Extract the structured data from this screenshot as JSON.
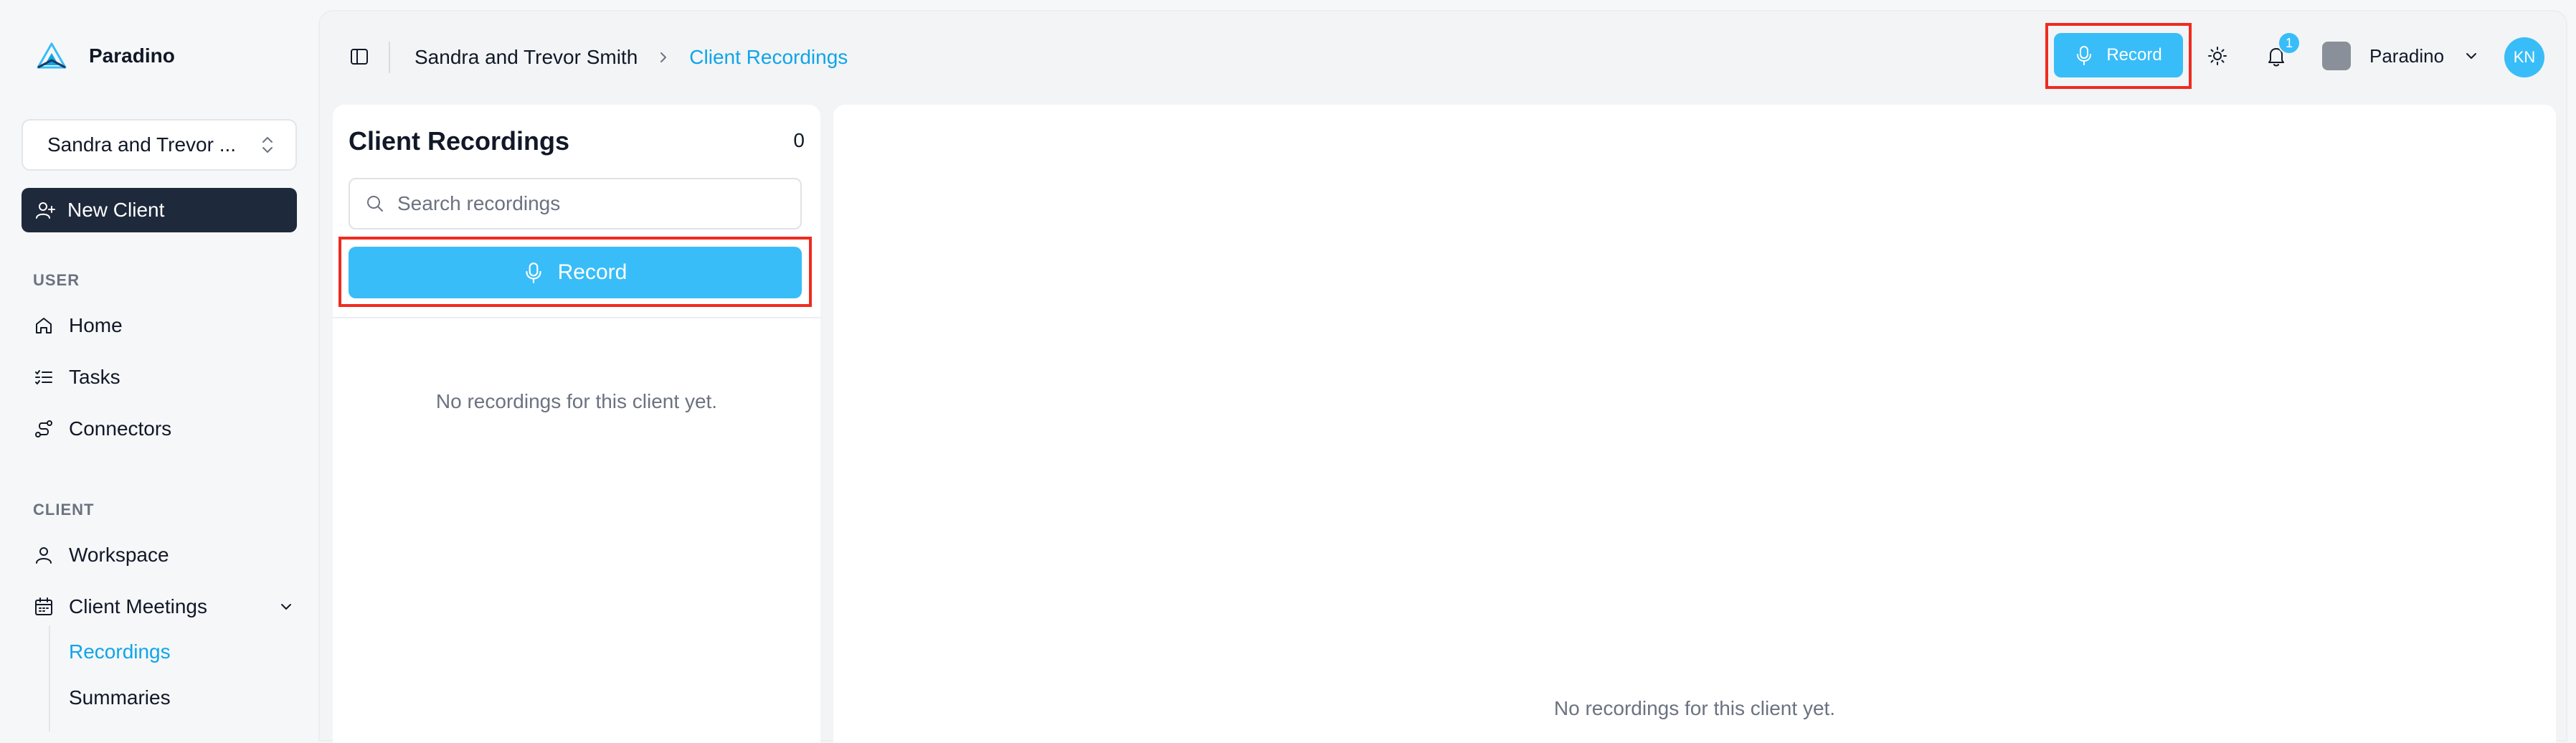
{
  "brand": {
    "name": "Paradino",
    "logo_icon": "paradino-logo-icon"
  },
  "sidebar": {
    "client_selector": {
      "value": "Sandra and Trevor ...",
      "icon": "chevrons-up-down-icon"
    },
    "new_client_label": "New Client",
    "user_section_label": "USER",
    "user_items": [
      {
        "label": "Home",
        "icon": "home-icon"
      },
      {
        "label": "Tasks",
        "icon": "list-checks-icon"
      },
      {
        "label": "Connectors",
        "icon": "route-icon"
      }
    ],
    "client_section_label": "CLIENT",
    "client_items": [
      {
        "label": "Workspace",
        "icon": "user-icon"
      },
      {
        "label": "Client Meetings",
        "icon": "calendar-icon",
        "expanded": true
      }
    ],
    "meeting_subitems": [
      {
        "label": "Recordings",
        "active": true
      },
      {
        "label": "Summaries",
        "active": false
      }
    ]
  },
  "topbar": {
    "breadcrumb": [
      "Sandra and Trevor Smith",
      "Client Recordings"
    ],
    "record_label": "Record",
    "notification_count": "1",
    "org_name": "Paradino",
    "user_initials": "KN"
  },
  "recordings": {
    "title": "Client Recordings",
    "count": "0",
    "search_placeholder": "Search recordings",
    "record_label": "Record",
    "empty_message": "No recordings for this client yet."
  },
  "detail": {
    "empty_message": "No recordings for this client yet."
  },
  "colors": {
    "accent": "#38bdf8",
    "accent_text": "#0ea5e9",
    "dark_button": "#1e293b",
    "highlight": "#ef2b1f"
  }
}
